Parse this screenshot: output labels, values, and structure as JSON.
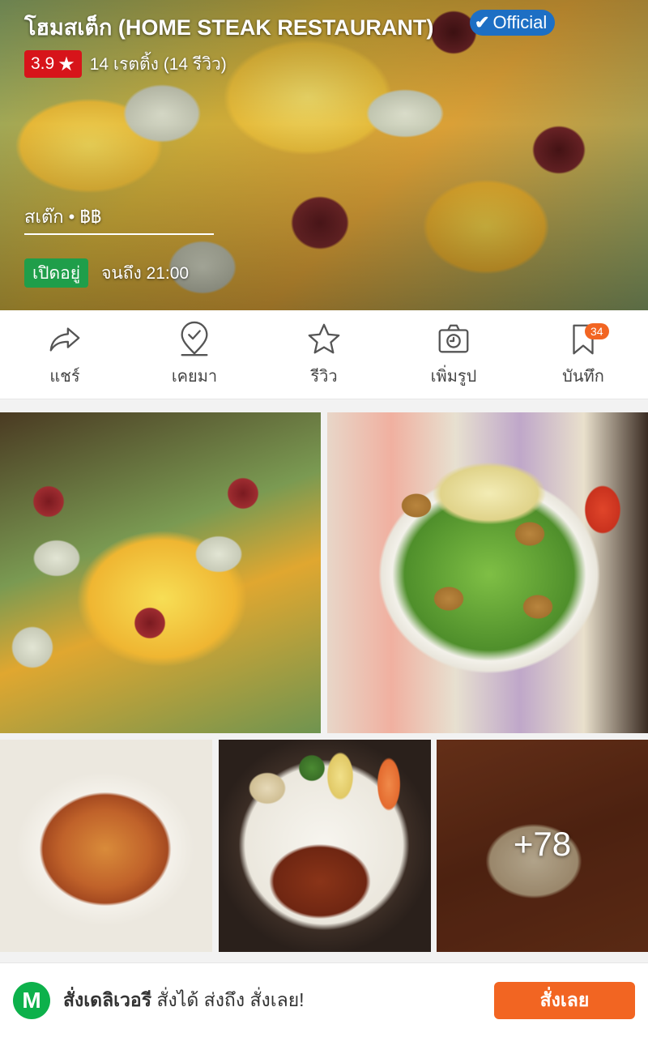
{
  "restaurant": {
    "name": "โฮมสเต็ก (HOME STEAK RESTAURANT)",
    "official_label": "Official",
    "rating": "3.9",
    "rating_summary": "14 เรตติ้ง (14 รีวิว)",
    "category": "สเต๊ก • ฿฿",
    "open_status": "เปิดอยู่",
    "hours": "จนถึง 21:00"
  },
  "colors": {
    "rating_red": "#d7141a",
    "official_blue": "#1d6fc4",
    "open_green": "#1f9e4a",
    "accent_orange": "#f26522",
    "lineman_green": "#0db14b"
  },
  "actions": [
    {
      "label": "แชร์",
      "icon": "share-icon"
    },
    {
      "label": "เคยมา",
      "icon": "location-check-icon"
    },
    {
      "label": "รีวิว",
      "icon": "star-outline-icon"
    },
    {
      "label": "เพิ่มรูป",
      "icon": "camera-icon"
    },
    {
      "label": "บันทึก",
      "icon": "bookmark-icon",
      "badge": "34"
    }
  ],
  "photos": {
    "more_count": "+78"
  },
  "delivery": {
    "logo_letter": "M",
    "title": "สั่งเดลิเวอรี",
    "subtitle": " สั่งได้ ส่งถึง สั่งเลย!",
    "button_label": "สั่งเลย"
  }
}
